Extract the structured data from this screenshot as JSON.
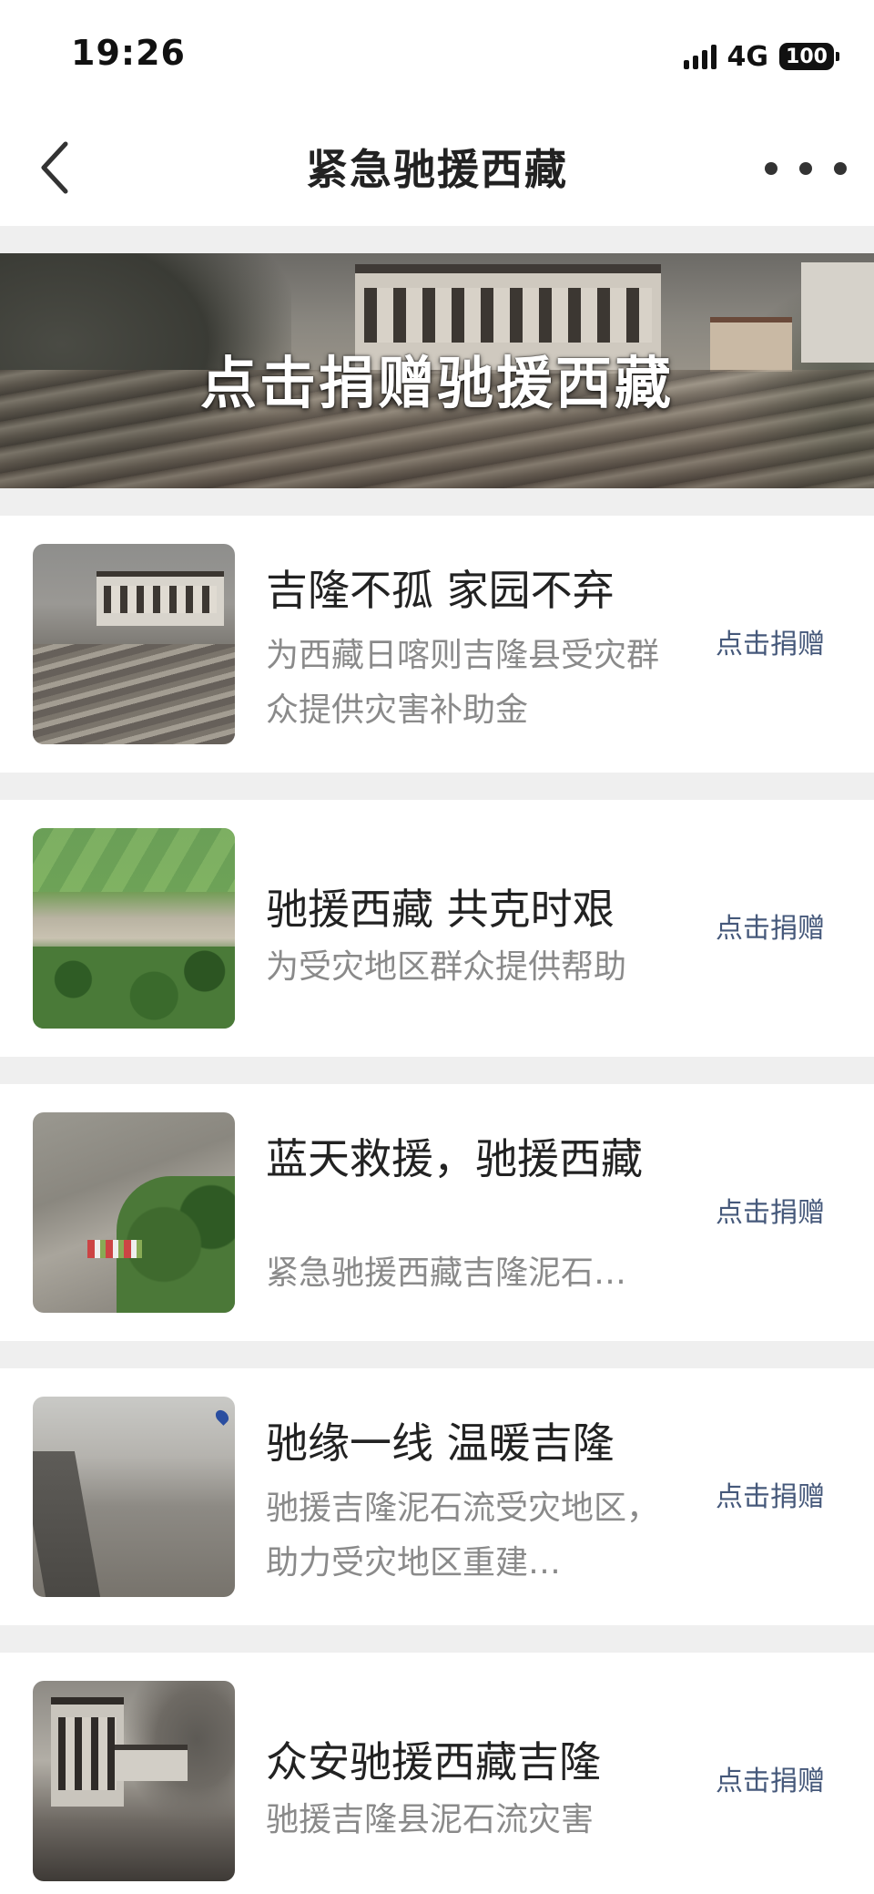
{
  "status_bar": {
    "time": "19:26",
    "network": "4G",
    "battery": "100"
  },
  "nav": {
    "title": "紧急驰援西藏",
    "back_icon": "chevron-left-icon",
    "more_icon": "more-horizontal-icon"
  },
  "banner": {
    "text": "点击捐赠驰援西藏"
  },
  "items": [
    {
      "title": "吉隆不孤 家园不弃",
      "desc": "为西藏日喀则吉隆县受灾群众提供灾害补助金",
      "action": "点击捐赠"
    },
    {
      "title": "驰援西藏 共克时艰",
      "desc": "为受灾地区群众提供帮助",
      "action": "点击捐赠"
    },
    {
      "title": "蓝天救援，驰援西藏",
      "desc": "紧急驰援西藏吉隆泥石…",
      "action": "点击捐赠"
    },
    {
      "title": "驰缘一线 温暖吉隆",
      "desc": "驰援吉隆泥石流受灾地区，助力受灾地区重建…",
      "action": "点击捐赠"
    },
    {
      "title": "众安驰援西藏吉隆",
      "desc": "驰援吉隆县泥石流灾害",
      "action": "点击捐赠"
    }
  ],
  "colors": {
    "link": "#45587a",
    "divider": "#efefef",
    "desc": "#8a8a8a"
  }
}
